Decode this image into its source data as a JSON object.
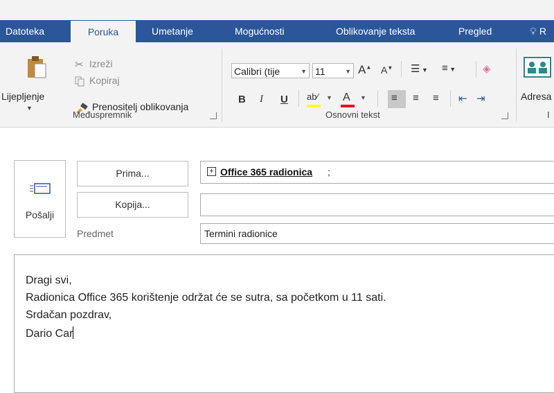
{
  "tabs": [
    {
      "label": "Datoteka",
      "active": false
    },
    {
      "label": "Poruka",
      "active": true
    },
    {
      "label": "Umetanje",
      "active": false
    },
    {
      "label": "Mogućnosti",
      "active": false
    },
    {
      "label": "Oblikovanje teksta",
      "active": false
    },
    {
      "label": "Pregled",
      "active": false
    },
    {
      "label": "R",
      "active": false
    }
  ],
  "ribbon": {
    "clipboard": {
      "paste": "Lijepljenje",
      "cut": "Izreži",
      "copy": "Kopiraj",
      "format_painter": "Prenositelj oblikovanja",
      "group_label": "Međuspremnik"
    },
    "basic_text": {
      "font_name": "Calibri (tije",
      "font_size": "11",
      "bold": "B",
      "italic": "I",
      "underline": "U",
      "group_label": "Osnovni tekst"
    },
    "names": {
      "address_book": "Adresa",
      "group_label_partial": "I"
    }
  },
  "compose": {
    "send": "Pošalji",
    "to_button": "Prima...",
    "cc_button": "Kopija...",
    "subject_label": "Predmet",
    "to_value": "Office 365 radionica",
    "to_separator": ";",
    "cc_value": "",
    "subject_value": "Termini radionice"
  },
  "body": {
    "lines": [
      "Dragi svi,",
      "Radionica Office 365 korištenje održat će se sutra, sa početkom u 11 sati.",
      "Srdačan pozdrav,",
      "Dario Car"
    ]
  },
  "colors": {
    "tab_bar": "#2b579a",
    "ribbon_bg": "#f3f3f3",
    "highlight_yellow": "#ffff00",
    "font_color_red": "#e81123"
  }
}
